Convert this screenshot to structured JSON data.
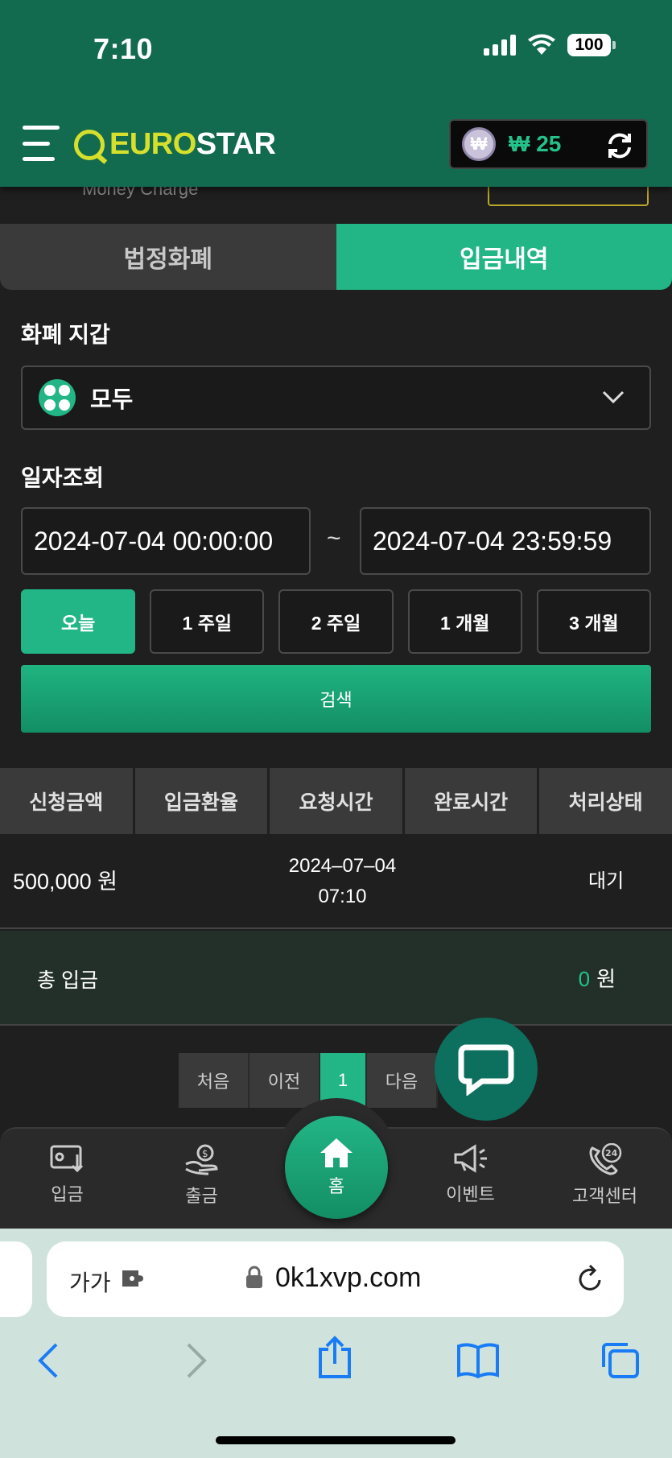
{
  "status_bar": {
    "time": "7:10",
    "battery": "100"
  },
  "header": {
    "logo_euro": "EURO",
    "logo_star": "STAR",
    "wallet_coin": "₩",
    "wallet_amount": "₩ 25"
  },
  "subheader": {
    "title": "Money Charge"
  },
  "tabs": [
    {
      "label": "법정화폐",
      "active": false
    },
    {
      "label": "입금내역",
      "active": true
    }
  ],
  "wallet_section": {
    "label": "화폐 지갑",
    "selected": "모두"
  },
  "date_section": {
    "label": "일자조회",
    "start": "2024-07-04 00:00:00",
    "end": "2024-07-04 23:59:59",
    "separator": "~"
  },
  "periods": [
    "오늘",
    "1 주일",
    "2 주일",
    "1 개월",
    "3 개월"
  ],
  "search_label": "검색",
  "table": {
    "headers": [
      "신청금액",
      "입금환율",
      "요청시간",
      "완료시간",
      "처리상태"
    ],
    "rows": [
      {
        "amount": "500,000 원",
        "rate": "",
        "request_date": "2024–07–04",
        "request_time": "07:10",
        "complete": "",
        "status": "대기"
      }
    ]
  },
  "total": {
    "label": "총 입금",
    "value": "0",
    "unit": "원"
  },
  "pagination": {
    "first": "처음",
    "prev": "이전",
    "current": "1",
    "next": "다음"
  },
  "bottom_nav": {
    "deposit": "입금",
    "withdraw": "출금",
    "home": "홈",
    "event": "이벤트",
    "support": "고객센터"
  },
  "browser": {
    "aa": "가가",
    "url": "0k1xvp.com"
  },
  "colors": {
    "primary": "#22b585",
    "header": "#136b4f",
    "logo": "#d6e02c"
  }
}
